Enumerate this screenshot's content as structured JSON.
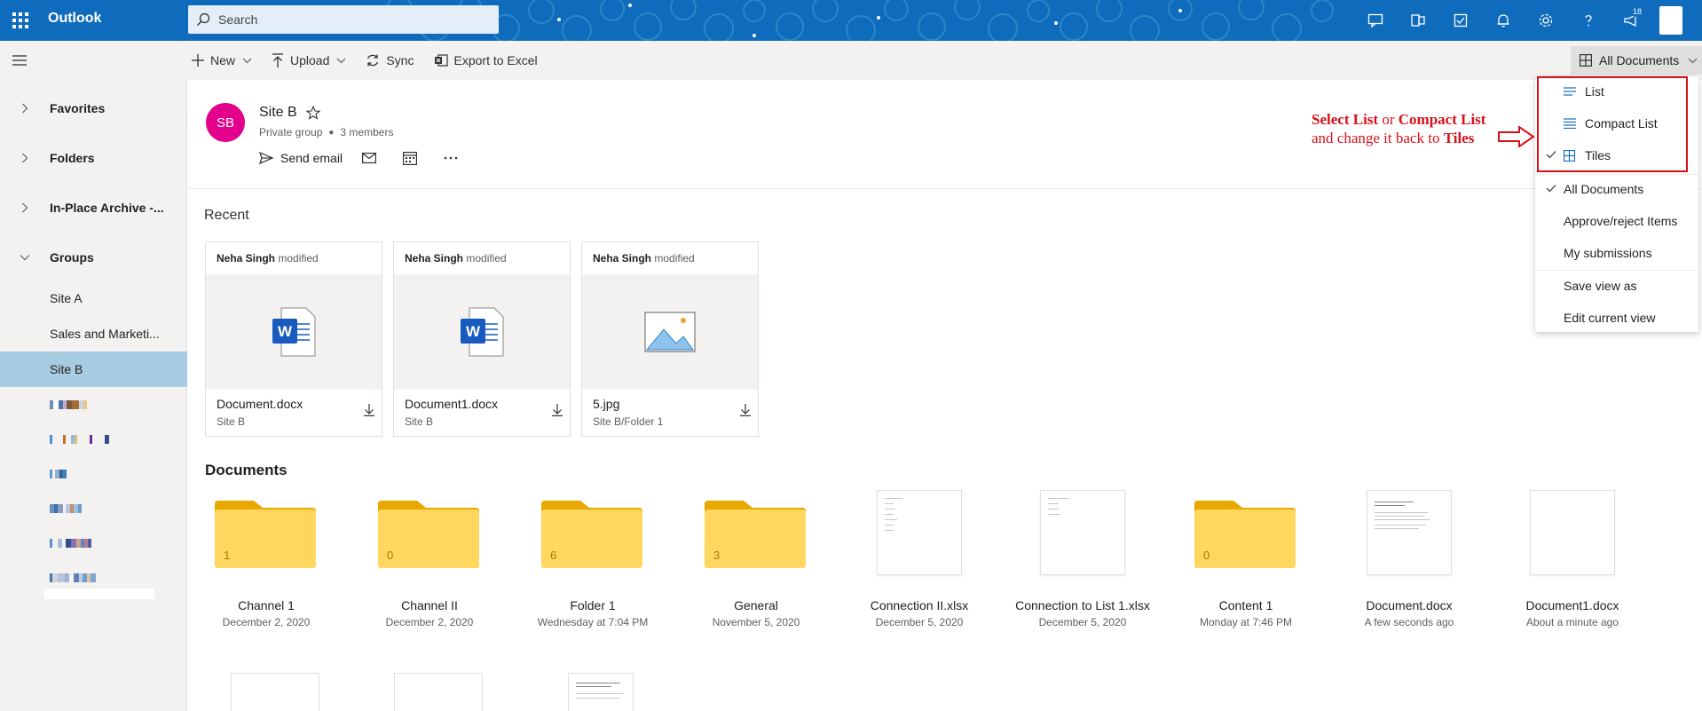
{
  "app": {
    "name": "Outlook",
    "search_placeholder": "Search",
    "notification_count": "18"
  },
  "command_bar": {
    "new_label": "New",
    "upload_label": "Upload",
    "sync_label": "Sync",
    "export_label": "Export to Excel",
    "view_label": "All Documents"
  },
  "left_pane": {
    "sections": [
      "Favorites",
      "Folders",
      "In-Place Archive -...",
      "Groups"
    ],
    "groups": [
      "Site A",
      "Sales and Marketi...",
      "Site B"
    ],
    "selected_group": "Site B"
  },
  "group": {
    "initials": "SB",
    "name": "Site B",
    "privacy": "Private group",
    "members": "3 members",
    "send_email_label": "Send email",
    "avatar_color": "#e3008c"
  },
  "recent": {
    "title": "Recent",
    "cards": [
      {
        "author": "Neha Singh",
        "action": "modified",
        "name": "Document.docx",
        "location": "Site B",
        "kind": "word-icon"
      },
      {
        "author": "Neha Singh",
        "action": "modified",
        "name": "Document1.docx",
        "location": "Site B",
        "kind": "word-icon"
      },
      {
        "author": "Neha Singh",
        "action": "modified",
        "name": "5.jpg",
        "location": "Site B/Folder 1",
        "kind": "image-icon"
      }
    ]
  },
  "documents": {
    "title": "Documents",
    "tiles": [
      {
        "name": "Channel 1",
        "date": "December 2, 2020",
        "type": "folder",
        "count": "1"
      },
      {
        "name": "Channel II",
        "date": "December 2, 2020",
        "type": "folder",
        "count": "0"
      },
      {
        "name": "Folder 1",
        "date": "Wednesday at 7:04 PM",
        "type": "folder",
        "count": "6"
      },
      {
        "name": "General",
        "date": "November 5, 2020",
        "type": "folder",
        "count": "3"
      },
      {
        "name": "Connection II.xlsx",
        "date": "December 5, 2020",
        "type": "file"
      },
      {
        "name": "Connection to List 1.xlsx",
        "date": "December 5, 2020",
        "type": "file"
      },
      {
        "name": "Content 1",
        "date": "Monday at 7:46 PM",
        "type": "folder",
        "count": "0"
      },
      {
        "name": "Document.docx",
        "date": "A few seconds ago",
        "type": "file"
      },
      {
        "name": "Document1.docx",
        "date": "About a minute ago",
        "type": "file"
      }
    ]
  },
  "view_menu": {
    "list": "List",
    "compact_list": "Compact List",
    "tiles": "Tiles",
    "all_documents": "All Documents",
    "approve_reject": "Approve/reject Items",
    "my_submissions": "My submissions",
    "save_view_as": "Save view as",
    "edit_current_view": "Edit current view"
  },
  "annotation": {
    "select_word": "Select",
    "list_word": "List",
    "or_word": "or",
    "compact_list_word": "Compact List",
    "change_back": "and change it back to",
    "tiles_word": "Tiles"
  },
  "colors": {
    "brand": "#0f6cbd",
    "selected_nav": "#a7cbe0",
    "annotation_red": "#d9101a",
    "folder_yellow": "#ffd75e"
  }
}
